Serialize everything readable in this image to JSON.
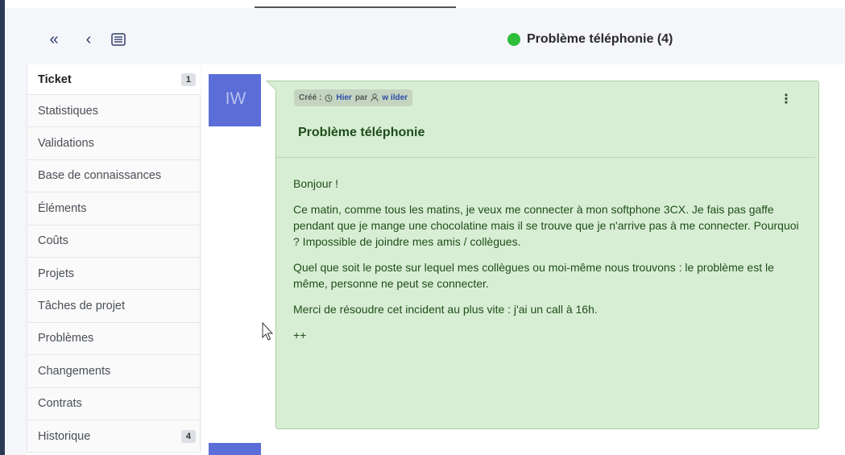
{
  "header": {
    "title": "Problème téléphonie (4)",
    "status_color": "#2ebd3a",
    "nav": [
      "double-chevron-left-icon",
      "chevron-left-icon",
      "list-icon"
    ]
  },
  "tabs": [
    {
      "label": "Ticket",
      "badge": "1",
      "active": true
    },
    {
      "label": "Statistiques"
    },
    {
      "label": "Validations"
    },
    {
      "label": "Base de connaissances"
    },
    {
      "label": "Éléments"
    },
    {
      "label": "Coûts"
    },
    {
      "label": "Projets"
    },
    {
      "label": "Tâches de projet"
    },
    {
      "label": "Problèmes"
    },
    {
      "label": "Changements"
    },
    {
      "label": "Contrats"
    },
    {
      "label": "Historique",
      "badge": "4"
    }
  ],
  "avatar": {
    "initials": "IW",
    "color": "#5b6ed8"
  },
  "ticket": {
    "meta_created": "Créé :",
    "meta_date": "Hier",
    "meta_by": "par",
    "meta_user": "w ilder",
    "title": "Problème téléphonie",
    "paragraphs": [
      "Bonjour !",
      "Ce matin, comme tous les matins, je veux me connecter à mon softphone 3CX. Je fais pas gaffe pendant que je mange une chocolatine mais il se trouve que je n'arrive pas à me connecter. Pourquoi ? Impossible de joindre mes amis / collègues.",
      "Quel que soit le poste sur lequel mes collègues ou moi-même nous trouvons : le problème est le même, personne ne peut se connecter.",
      "Merci de résoudre cet incident au plus vite : j'ai un call à 16h.",
      "++"
    ],
    "bubble_color": "#d8eed4"
  }
}
